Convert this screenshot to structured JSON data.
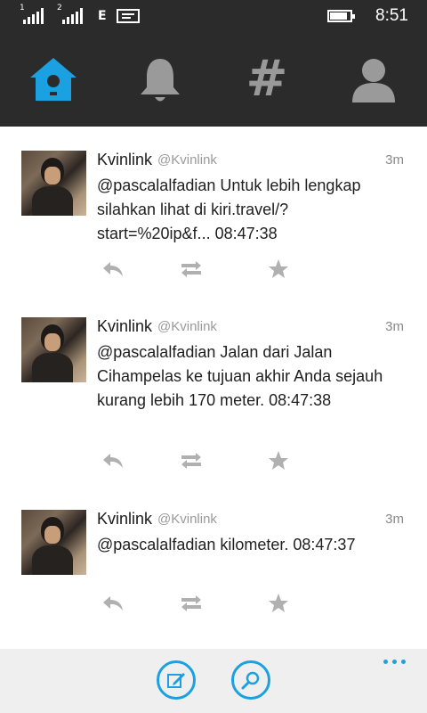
{
  "status_bar": {
    "signal1_tag": "1",
    "signal2_tag": "2",
    "network_type": "E",
    "battery_level": 0.85,
    "time": "8:51"
  },
  "nav": {
    "items": [
      {
        "name": "home",
        "icon": "home-icon"
      },
      {
        "name": "notifications",
        "icon": "bell-icon"
      },
      {
        "name": "discover",
        "icon": "hashtag-icon",
        "glyph": "#"
      },
      {
        "name": "profile",
        "icon": "person-icon"
      }
    ],
    "active": "home",
    "accent": "#1ba1e2"
  },
  "tweets": [
    {
      "name": "Kvinlink",
      "handle": "@Kvinlink",
      "time": "3m",
      "text": "@pascalalfadian Untuk lebih lengkap silahkan lihat di kiri.travel/?start=%20ip&f...  08:47:38"
    },
    {
      "name": "Kvinlink",
      "handle": "@Kvinlink",
      "time": "3m",
      "text": "@pascalalfadian Jalan dari Jalan Cihampelas ke tujuan akhir Anda sejauh kurang lebih 170 meter.  08:47:38"
    },
    {
      "name": "Kvinlink",
      "handle": "@Kvinlink",
      "time": "3m",
      "text": "@pascalalfadian kilometer.  08:47:37"
    }
  ],
  "app_bar": {
    "buttons": [
      {
        "name": "compose",
        "icon": "compose-icon"
      },
      {
        "name": "search",
        "icon": "search-icon"
      }
    ],
    "more_icon": "ellipsis-icon",
    "accent": "#1ba1e2"
  }
}
